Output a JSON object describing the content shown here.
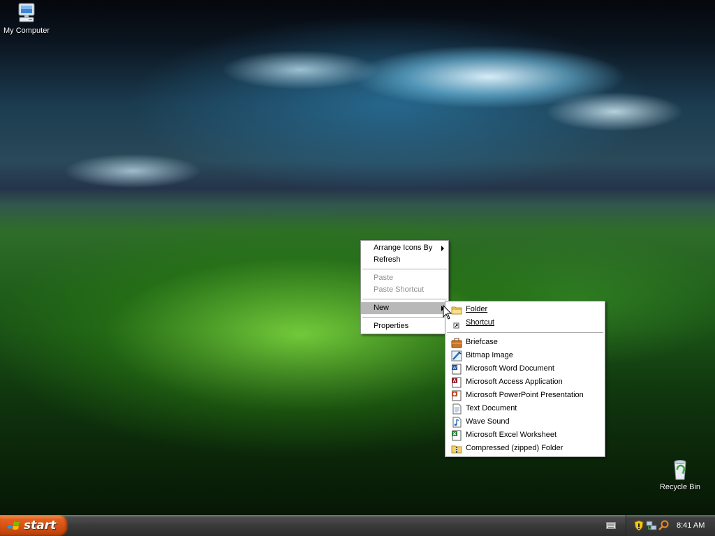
{
  "desktop": {
    "icons": [
      {
        "label": "My Computer",
        "icon": "my-computer-icon"
      },
      {
        "label": "Recycle Bin",
        "icon": "recycle-bin-icon"
      }
    ]
  },
  "context_menu": {
    "items": [
      {
        "label": "Arrange Icons By",
        "has_submenu": true,
        "enabled": true
      },
      {
        "label": "Refresh",
        "enabled": true
      },
      {
        "label": "Paste",
        "enabled": false
      },
      {
        "label": "Paste Shortcut",
        "enabled": false
      },
      {
        "label": "New",
        "has_submenu": true,
        "enabled": true,
        "highlighted": true
      },
      {
        "label": "Properties",
        "enabled": true
      }
    ]
  },
  "new_submenu": {
    "items": [
      {
        "label": "Folder",
        "icon": "folder-icon"
      },
      {
        "label": "Shortcut",
        "icon": "shortcut-icon"
      },
      {
        "label": "Briefcase",
        "icon": "briefcase-icon"
      },
      {
        "label": "Bitmap Image",
        "icon": "bitmap-icon"
      },
      {
        "label": "Microsoft Word Document",
        "icon": "word-icon"
      },
      {
        "label": "Microsoft Access Application",
        "icon": "access-icon"
      },
      {
        "label": "Microsoft PowerPoint Presentation",
        "icon": "powerpoint-icon"
      },
      {
        "label": "Text Document",
        "icon": "text-document-icon"
      },
      {
        "label": "Wave Sound",
        "icon": "wave-sound-icon"
      },
      {
        "label": "Microsoft Excel Worksheet",
        "icon": "excel-icon"
      },
      {
        "label": "Compressed (zipped) Folder",
        "icon": "zip-folder-icon"
      }
    ]
  },
  "taskbar": {
    "start_label": "start",
    "clock": "8:41 AM",
    "tray_icons": [
      "security-shield-icon",
      "network-icon",
      "search-tray-icon"
    ]
  },
  "colors": {
    "start_button": "#e4601e",
    "taskbar": "#3a3a3a",
    "menu_highlight": "#b8b8b8",
    "disabled_text": "#8f8f8f"
  }
}
